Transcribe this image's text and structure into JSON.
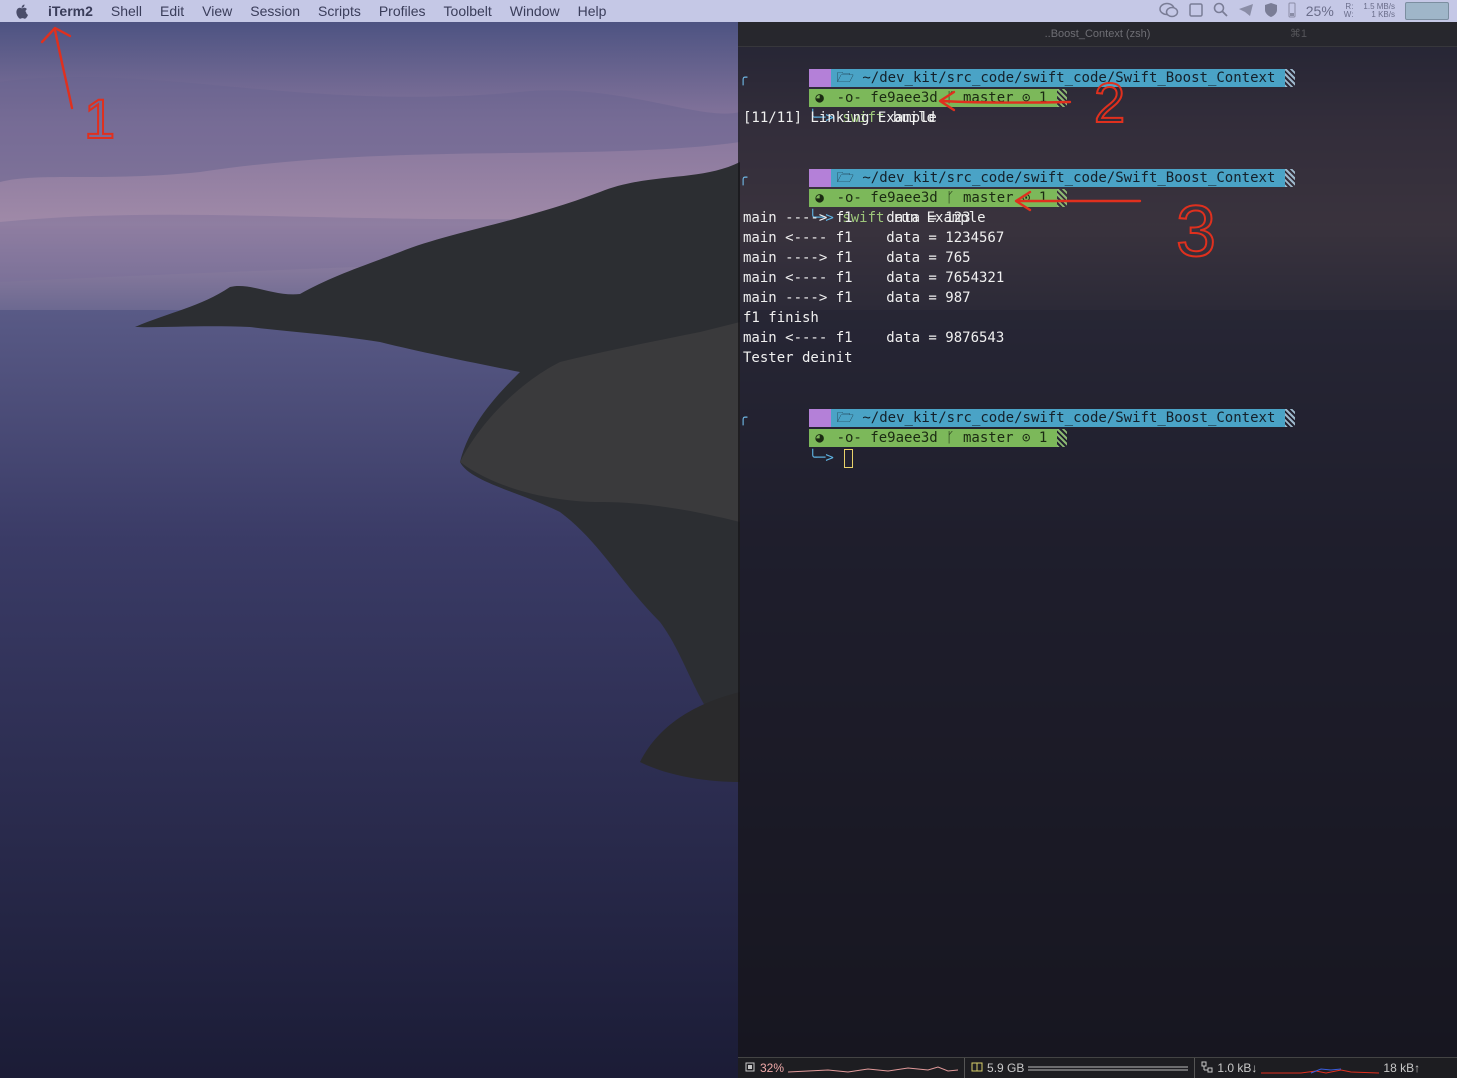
{
  "menubar": {
    "app_name": "iTerm2",
    "menus": [
      "Shell",
      "Edit",
      "View",
      "Session",
      "Scripts",
      "Profiles",
      "Toolbelt",
      "Window",
      "Help"
    ],
    "status": {
      "battery_text": "25%",
      "net_read_label": "R:",
      "net_write_label": "W:",
      "net_read": "1.5 MB/s",
      "net_write": "1 KB/s"
    }
  },
  "terminal": {
    "title": "..Boost_Context (zsh)",
    "shortcut": "⌘1",
    "prompt": {
      "path": "~/dev_kit/src_code/swift_code/Swift_Boost_Context",
      "commit": "fe9aee3d",
      "branch": "master",
      "ahead": "1"
    },
    "cmd1": {
      "name": "swift",
      "args": " build"
    },
    "out1": [
      "[11/11] Linking Example"
    ],
    "cmd2": {
      "name": "swift",
      "args": " run Example"
    },
    "out2": [
      "main ----> f1    data = 123",
      "main <---- f1    data = 1234567",
      "main ----> f1    data = 765",
      "main <---- f1    data = 7654321",
      "main ----> f1    data = 987",
      "f1 finish",
      "main <---- f1    data = 9876543",
      "Tester deinit"
    ],
    "statusbar": {
      "cpu": "32%",
      "mem": "5.9 GB",
      "net_down": "1.0 kB↓",
      "net_up": "18 kB↑"
    }
  },
  "annotations": {
    "labels": [
      "1",
      "2",
      "3"
    ]
  },
  "colors": {
    "menubar_bg": "#c5c8e6",
    "prompt_apple": "#b480d8",
    "prompt_path": "#4aa3c6",
    "prompt_git": "#7cb85a",
    "annotation_red": "#e0301e"
  }
}
